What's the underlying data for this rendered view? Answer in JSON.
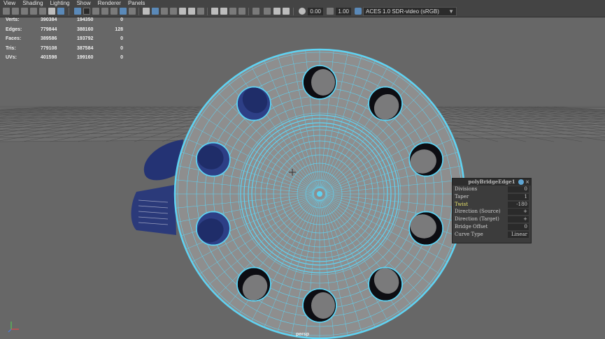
{
  "menu": [
    "View",
    "Shading",
    "Lighting",
    "Show",
    "Renderer",
    "Panels"
  ],
  "toolbar": {
    "near_clip": "0.00",
    "far_clip": "1.00",
    "color_space": "ACES 1.0 SDR-video (sRGB)",
    "icons": [
      "camera-icon",
      "bookmark-icon",
      "image-plane-icon",
      "2d-pan-icon",
      "grease-pencil-icon",
      "grid-icon",
      "film-gate-icon",
      "resolution-gate-icon",
      "safe-action-icon",
      "wireframe-icon",
      "smooth-shade-icon",
      "textured-icon",
      "lights-icon",
      "shadows-icon",
      "ambient-occlusion-icon",
      "motion-blur-icon",
      "isolate-icon",
      "xray-icon",
      "xray-joints-icon",
      "backface-icon",
      "exposure-icon",
      "gamma-icon",
      "colorspace-icon"
    ]
  },
  "hud": {
    "rows": [
      {
        "label": "Verts:",
        "v1": "390384",
        "v2": "194350",
        "v3": "0"
      },
      {
        "label": "Edges:",
        "v1": "779844",
        "v2": "388160",
        "v3": "128"
      },
      {
        "label": "Faces:",
        "v1": "389586",
        "v2": "193792",
        "v3": "0"
      },
      {
        "label": "Tris:",
        "v1": "779108",
        "v2": "387584",
        "v3": "0"
      },
      {
        "label": "UVs:",
        "v1": "401598",
        "v2": "199160",
        "v3": "0"
      }
    ]
  },
  "camera_label": "persp",
  "channel_box": {
    "title": "polyBridgeEdge1",
    "rows": [
      {
        "label": "Divisions",
        "value": "0"
      },
      {
        "label": "Taper",
        "value": "1"
      },
      {
        "label": "Twist",
        "value": "-180",
        "highlight": true
      },
      {
        "label": "Direction (Source)",
        "value": "+"
      },
      {
        "label": "Direction (Target)",
        "value": "+"
      },
      {
        "label": "Bridge Offset",
        "value": "0"
      },
      {
        "label": "Curve Type",
        "value": "Linear"
      }
    ]
  },
  "colors": {
    "wire": "#5fd3f3",
    "mesh": "#8e8e8e",
    "viewport_bg": "#676767",
    "hole_blue": "#2d3f86"
  }
}
